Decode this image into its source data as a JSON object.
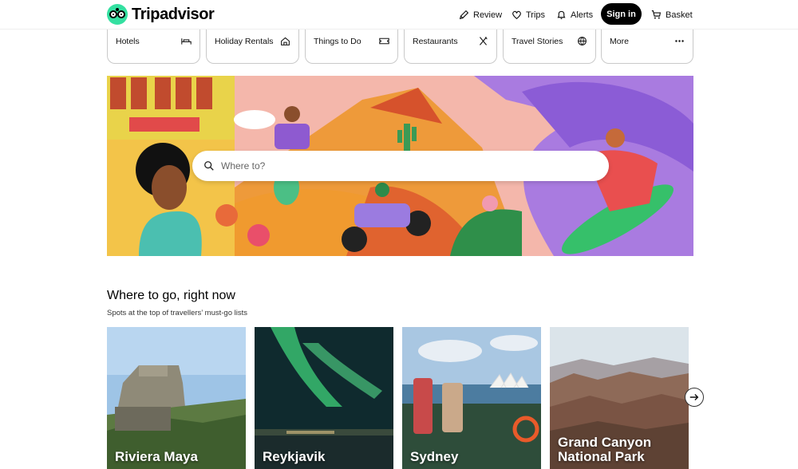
{
  "brand": {
    "name": "Tripadvisor"
  },
  "header": {
    "review": "Review",
    "trips": "Trips",
    "alerts": "Alerts",
    "signin": "Sign in",
    "basket": "Basket"
  },
  "categories": [
    {
      "label": "Hotels",
      "icon": "bed-icon"
    },
    {
      "label": "Holiday Rentals",
      "icon": "house-icon"
    },
    {
      "label": "Things to Do",
      "icon": "ticket-icon"
    },
    {
      "label": "Restaurants",
      "icon": "utensils-icon"
    },
    {
      "label": "Travel Stories",
      "icon": "globe-icon"
    },
    {
      "label": "More",
      "icon": "more-dots-icon"
    }
  ],
  "search": {
    "placeholder": "Where to?"
  },
  "section": {
    "title": "Where to go, right now",
    "subtitle": "Spots at the top of travellers’ must-go lists"
  },
  "destinations": [
    {
      "name": "Riviera Maya"
    },
    {
      "name": "Reykjavik"
    },
    {
      "name": "Sydney"
    },
    {
      "name": "Grand Canyon National Park"
    }
  ],
  "colors": {
    "brand_green": "#34e0a1",
    "black": "#000000"
  }
}
